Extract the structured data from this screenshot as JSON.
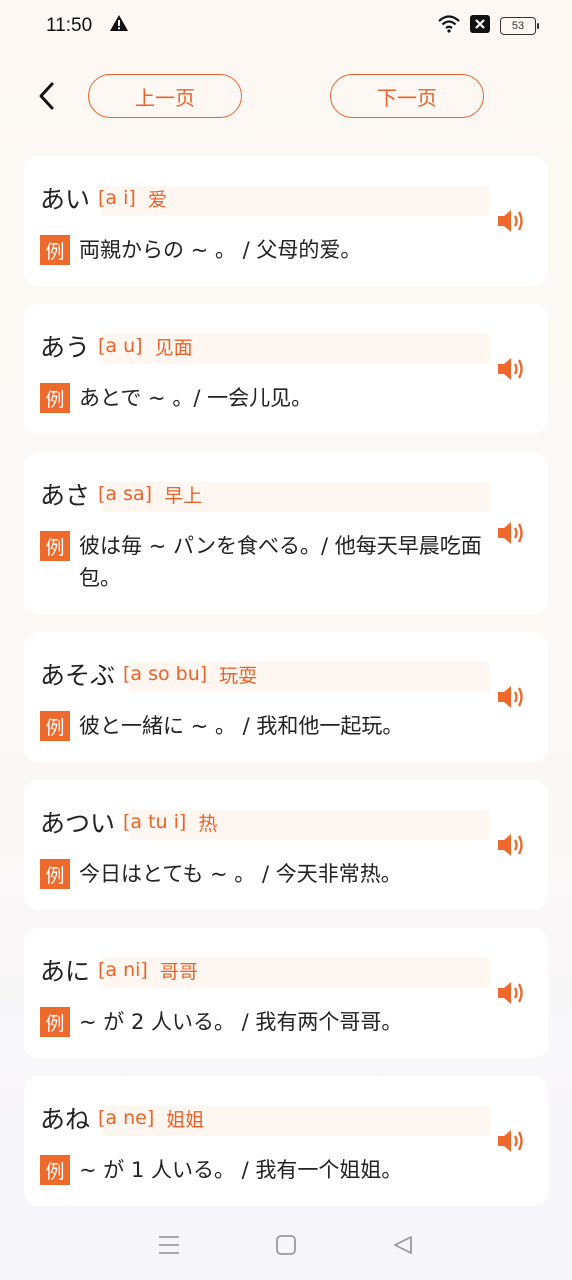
{
  "status_bar": {
    "time": "11:50",
    "battery": "53",
    "icons": [
      "alert-icon",
      "wifi-icon",
      "no-sim-icon",
      "battery-icon"
    ]
  },
  "header": {
    "prev_label": "上一页",
    "next_label": "下一页"
  },
  "colors": {
    "accent": "#e8632b",
    "badge": "#ee6a2c",
    "card": "#ffffff"
  },
  "words": [
    {
      "word": "あい",
      "reading": "[a i]",
      "meaning": "爱",
      "badge": "例",
      "example": "両親からの ~ 。 / 父母的爱。"
    },
    {
      "word": "あう",
      "reading": "[a u]",
      "meaning": "见面",
      "badge": "例",
      "example": "あとで ~ 。/ 一会儿见。"
    },
    {
      "word": "あさ",
      "reading": "[a sa]",
      "meaning": "早上",
      "badge": "例",
      "example": "彼は毎 ~ パンを食べる。/ 他每天早晨吃面包。"
    },
    {
      "word": "あそぶ",
      "reading": "[a so bu]",
      "meaning": "玩耍",
      "badge": "例",
      "example": "彼と一緒に ~ 。 / 我和他一起玩。"
    },
    {
      "word": "あつい",
      "reading": "[a tu i]",
      "meaning": "热",
      "badge": "例",
      "example": "今日はとても ~ 。 / 今天非常热。"
    },
    {
      "word": "あに",
      "reading": "[a ni]",
      "meaning": "哥哥",
      "badge": "例",
      "example": "~ が 2 人いる。 / 我有两个哥哥。"
    },
    {
      "word": "あね",
      "reading": "[a ne]",
      "meaning": "姐姐",
      "badge": "例",
      "example": "~ が 1 人いる。 / 我有一个姐姐。"
    }
  ]
}
